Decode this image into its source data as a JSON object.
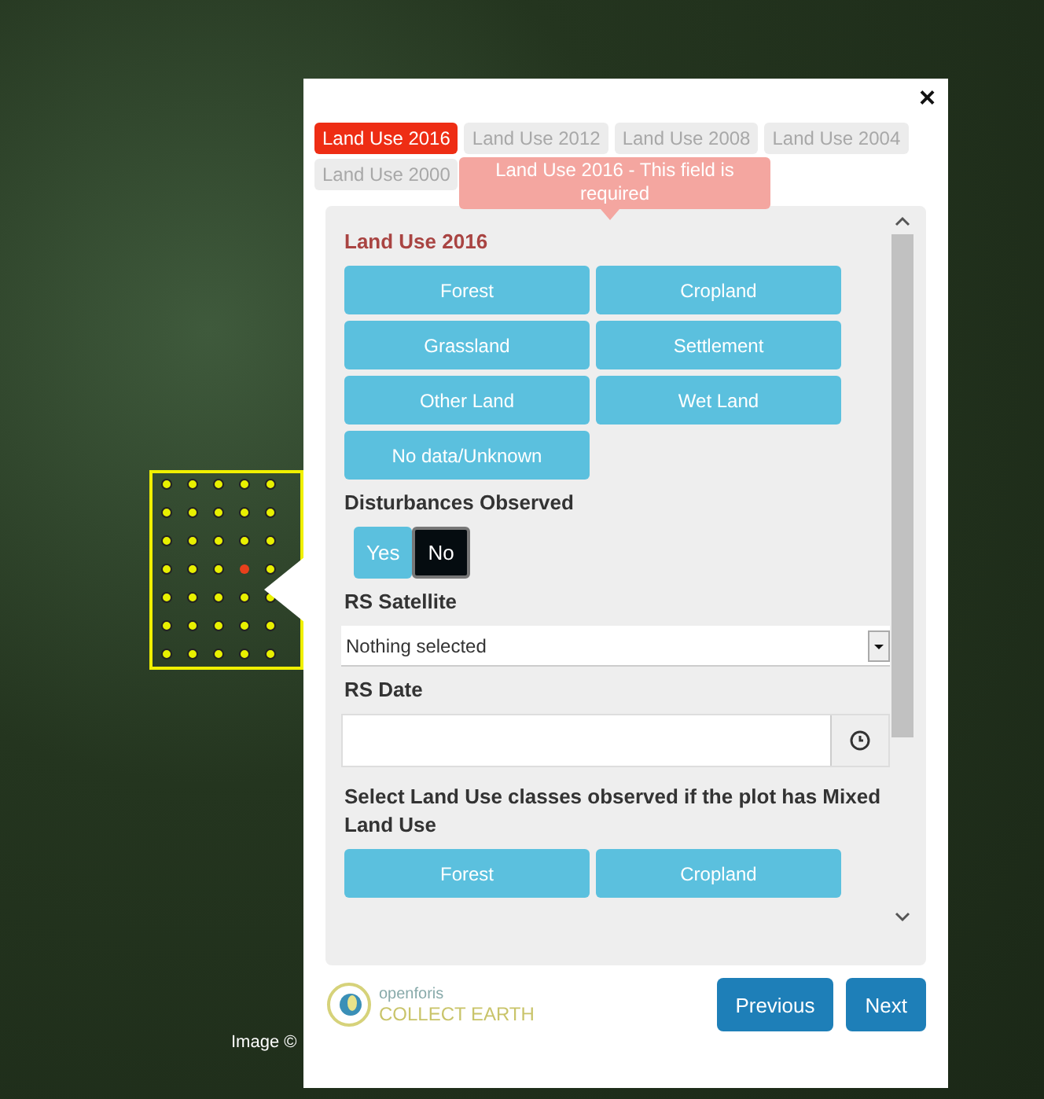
{
  "map": {
    "credit": "Image ©"
  },
  "dialog": {
    "close": "×",
    "tabs": [
      {
        "label": "Land Use 2016",
        "selected": true
      },
      {
        "label": "Land Use 2012",
        "selected": false
      },
      {
        "label": "Land Use 2008",
        "selected": false
      },
      {
        "label": "Land Use 2004",
        "selected": false
      },
      {
        "label": "Land Use 2000",
        "selected": false
      }
    ],
    "tooltip": "Land Use 2016 - This field is required",
    "land_use": {
      "title": "Land Use 2016",
      "options": [
        {
          "label": "Forest",
          "selected": false
        },
        {
          "label": "Cropland",
          "selected": false
        },
        {
          "label": "Grassland",
          "selected": false
        },
        {
          "label": "Settlement",
          "selected": false
        },
        {
          "label": "Other Land",
          "selected": false
        },
        {
          "label": "Wet Land",
          "selected": false
        },
        {
          "label": "No data/Unknown",
          "selected": false
        }
      ]
    },
    "disturbances": {
      "title": "Disturbances Observed",
      "options": [
        {
          "label": "Yes",
          "selected": false
        },
        {
          "label": "No",
          "selected": true
        }
      ]
    },
    "rs_satellite": {
      "title": "RS Satellite",
      "value": "Nothing selected"
    },
    "rs_date": {
      "title": "RS Date"
    },
    "mixed_land_use": {
      "title": "Select Land Use classes observed if the plot has Mixed Land Use",
      "options": [
        {
          "label": "Forest",
          "selected": false
        },
        {
          "label": "Cropland",
          "selected": false
        }
      ]
    },
    "logo": {
      "line1": "openforis",
      "line2": "COLLECT EARTH"
    },
    "buttons": [
      "Previous",
      "Next"
    ]
  }
}
